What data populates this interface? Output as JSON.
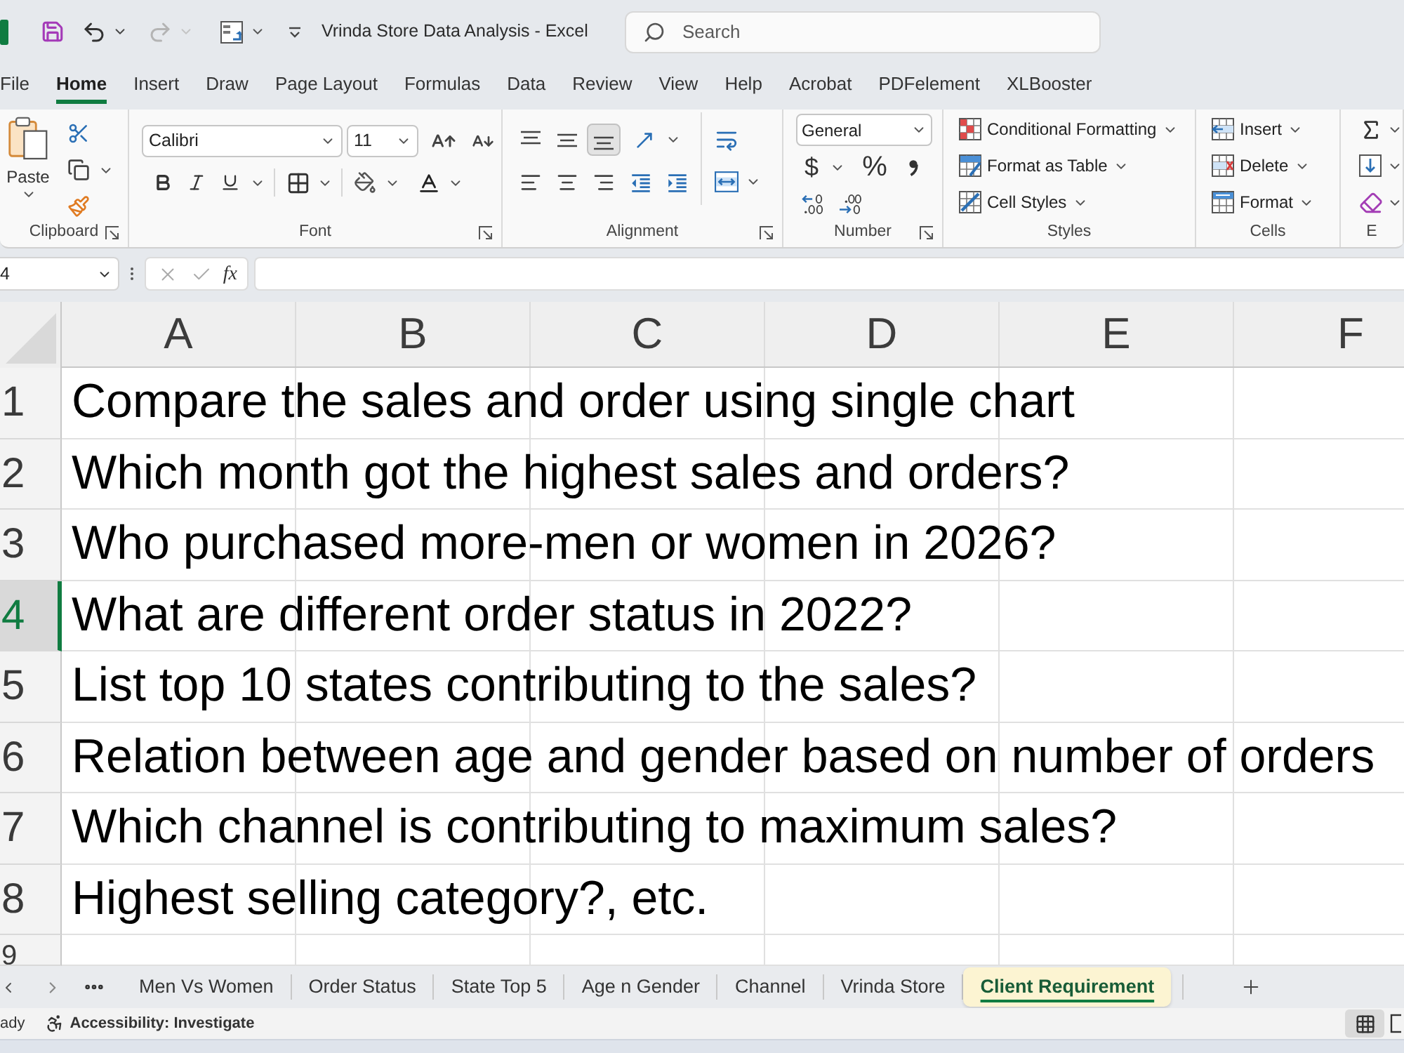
{
  "title_bar": {
    "title": "Vrinda Store Data Analysis - Excel",
    "undo": {
      "disabled": false
    },
    "redo": {
      "disabled": true
    },
    "search": {
      "placeholder": "Search"
    }
  },
  "ribbon_tabs": [
    {
      "label": "File",
      "selected": false
    },
    {
      "label": "Home",
      "selected": true
    },
    {
      "label": "Insert",
      "selected": false
    },
    {
      "label": "Draw",
      "selected": false
    },
    {
      "label": "Page Layout",
      "selected": false
    },
    {
      "label": "Formulas",
      "selected": false
    },
    {
      "label": "Data",
      "selected": false
    },
    {
      "label": "Review",
      "selected": false
    },
    {
      "label": "View",
      "selected": false
    },
    {
      "label": "Help",
      "selected": false
    },
    {
      "label": "Acrobat",
      "selected": false
    },
    {
      "label": "PDFelement",
      "selected": false
    },
    {
      "label": "XLBooster",
      "selected": false
    }
  ],
  "ribbon_groups": [
    {
      "kind": "clipboard",
      "label": "Clipboard",
      "launcher": true,
      "paste_label": "Paste"
    },
    {
      "kind": "font",
      "label": "Font",
      "launcher": true,
      "font_name": "Calibri",
      "font_size": "11"
    },
    {
      "kind": "alignment",
      "label": "Alignment",
      "launcher": true,
      "vertical_align": [
        {
          "kind": "top",
          "selected": false
        },
        {
          "kind": "middle",
          "selected": false
        },
        {
          "kind": "bottom",
          "selected": true
        }
      ]
    },
    {
      "kind": "number",
      "label": "Number",
      "launcher": true,
      "format": "General",
      "currency": "$",
      "percent": "%"
    },
    {
      "kind": "styles",
      "label": "Styles",
      "commands": [
        {
          "kind": "conditional",
          "label": "Conditional Formatting"
        },
        {
          "kind": "table",
          "label": "Format as Table"
        },
        {
          "kind": "cell_styles",
          "label": "Cell Styles"
        }
      ]
    },
    {
      "kind": "cells",
      "label": "Cells",
      "commands": [
        {
          "kind": "insert",
          "label": "Insert"
        },
        {
          "kind": "delete",
          "label": "Delete"
        },
        {
          "kind": "format",
          "label": "Format"
        }
      ]
    },
    {
      "kind": "editing",
      "label": "E"
    }
  ],
  "formula_bar": {
    "name_box": "4",
    "cancel": {
      "disabled": true
    },
    "enter": {
      "disabled": true
    },
    "function_label": "fx"
  },
  "sheet": {
    "columns": [
      "A",
      "B",
      "C",
      "D",
      "E",
      "F"
    ],
    "rows": [
      {
        "number": "1",
        "text": "Compare the sales and order using single chart",
        "selected": false
      },
      {
        "number": "2",
        "text": "Which month got the highest sales and orders?",
        "selected": false
      },
      {
        "number": "3",
        "text": "Who purchased more-men or women in 2026?",
        "selected": false
      },
      {
        "number": "4",
        "text": "What are different order status in 2022?",
        "selected": true
      },
      {
        "number": "5",
        "text": "List top 10 states contributing to the sales?",
        "selected": false
      },
      {
        "number": "6",
        "text": "Relation between age and gender based on number of orders",
        "selected": false
      },
      {
        "number": "7",
        "text": "Which channel is contributing to maximum sales?",
        "selected": false
      },
      {
        "number": "8",
        "text": "Highest selling category?, etc.",
        "selected": false
      },
      {
        "number": "9",
        "selected": false
      }
    ]
  },
  "sheet_tabs": [
    {
      "label": "Men Vs Women",
      "selected": false
    },
    {
      "label": "Order Status",
      "selected": false
    },
    {
      "label": "State Top 5",
      "selected": false
    },
    {
      "label": "Age n Gender",
      "selected": false
    },
    {
      "label": "Channel",
      "selected": false
    },
    {
      "label": "Vrinda Store",
      "selected": false
    },
    {
      "label": "Client Requirement",
      "selected": true
    }
  ],
  "status_bar": {
    "status": "ady",
    "accessibility": "Accessibility: Investigate",
    "views": [
      {
        "kind": "normal",
        "selected": true
      },
      {
        "kind": "page_layout",
        "selected": false
      }
    ]
  }
}
